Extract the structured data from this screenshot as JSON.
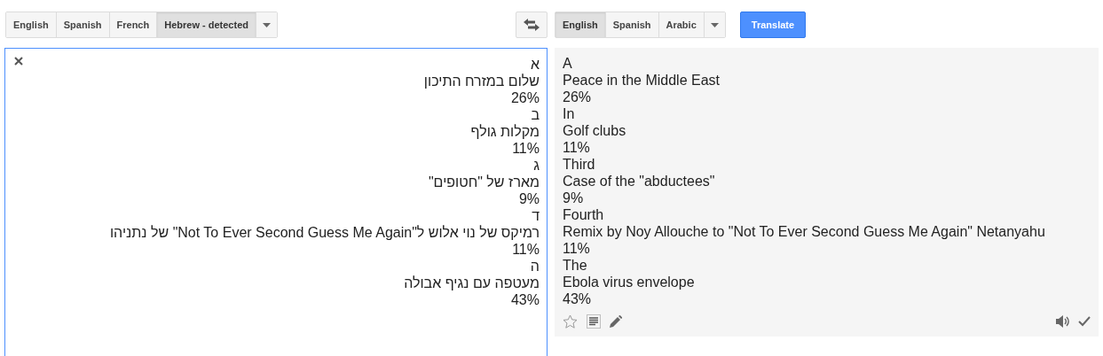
{
  "source_languages": [
    {
      "label": "English",
      "selected": false
    },
    {
      "label": "Spanish",
      "selected": false
    },
    {
      "label": "French",
      "selected": false
    },
    {
      "label": "Hebrew - detected",
      "selected": true
    }
  ],
  "target_languages": [
    {
      "label": "English",
      "selected": true
    },
    {
      "label": "Spanish",
      "selected": false
    },
    {
      "label": "Arabic",
      "selected": false
    }
  ],
  "translate_button": "Translate",
  "source_lines": [
    "א",
    "שלום במזרח התיכון",
    "26%",
    "ב",
    "מקלות גולף",
    "11%",
    "ג",
    "מארז של \"חטופים\"",
    "9%",
    "ד",
    "רמיקס של נוי אלוש ל\"Not To Ever Second Guess Me Again\" של נתניהו",
    "11%",
    "ה",
    "מעטפה עם נגיף אבולה",
    "43%"
  ],
  "translation_lines": [
    "A",
    "Peace in the Middle East",
    "26%",
    "In",
    "Golf clubs",
    "11%",
    "Third",
    "Case of the \"abductees\"",
    "9%",
    "Fourth",
    "Remix by Noy Allouche to \"Not To Ever Second Guess Me Again\" Netanyahu",
    "11%",
    "The",
    "Ebola virus envelope",
    "43%"
  ]
}
